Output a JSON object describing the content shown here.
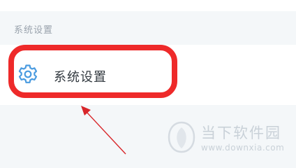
{
  "section": {
    "header": "系统设置"
  },
  "settings_item": {
    "icon": "gear-icon",
    "label": "系统设置"
  },
  "annotation": {
    "color": "#ee2a2a"
  },
  "watermark": {
    "logo": "downxia-logo",
    "title": "当下软件园",
    "url": "www.downxia.com"
  }
}
